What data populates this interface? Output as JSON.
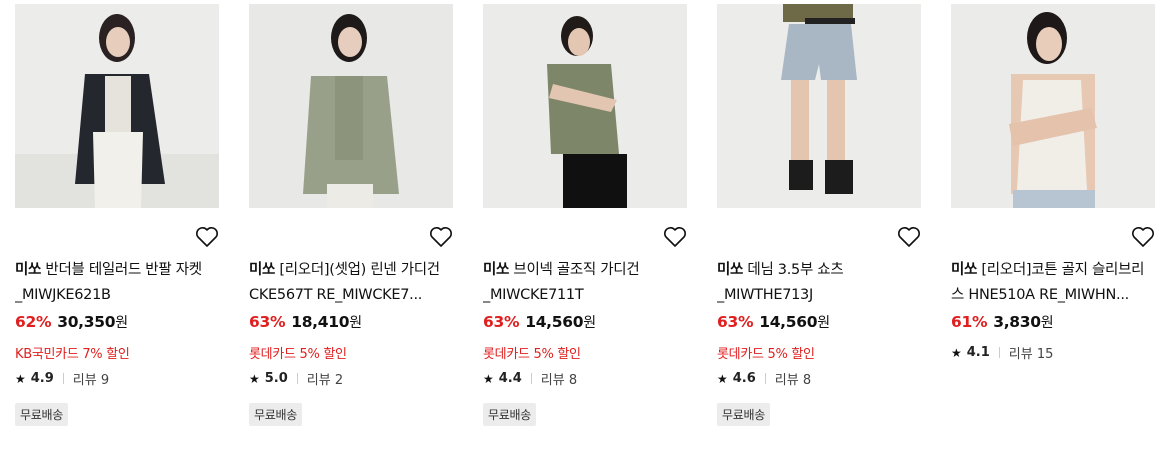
{
  "products": [
    {
      "brand": "미쏘",
      "name": "반더블 테일러드 반팔 자켓_MIWJKE621B",
      "discount": "62%",
      "price": "30,350",
      "currency": "원",
      "card_promo": "KB국민카드 7% 할인",
      "rating": "4.9",
      "reviews": "리뷰 9",
      "badge": "무료배송"
    },
    {
      "brand": "미쏘",
      "name": "[리오더](셋업) 린넨 가디건 CKE567T RE_MIWCKE7...",
      "discount": "63%",
      "price": "18,410",
      "currency": "원",
      "card_promo": "롯데카드 5% 할인",
      "rating": "5.0",
      "reviews": "리뷰 2",
      "badge": "무료배송"
    },
    {
      "brand": "미쏘",
      "name": "브이넥 골조직 가디건_MIWCKE711T",
      "discount": "63%",
      "price": "14,560",
      "currency": "원",
      "card_promo": "롯데카드 5% 할인",
      "rating": "4.4",
      "reviews": "리뷰 8",
      "badge": "무료배송"
    },
    {
      "brand": "미쏘",
      "name": "데님 3.5부 쇼츠_MIWTHE713J",
      "discount": "63%",
      "price": "14,560",
      "currency": "원",
      "card_promo": "롯데카드 5% 할인",
      "rating": "4.6",
      "reviews": "리뷰 8",
      "badge": "무료배송"
    },
    {
      "brand": "미쏘",
      "name": "[리오더]코튼 골지 슬리브리스 HNE510A RE_MIWHN...",
      "discount": "61%",
      "price": "3,830",
      "currency": "원",
      "rating": "4.1",
      "reviews": "리뷰 15"
    }
  ],
  "icons": {
    "wishlist": "heart-outline-icon",
    "rating": "star-icon"
  },
  "colors": {
    "discount": "#e02020",
    "promo": "#e02020",
    "badge_bg": "#ececec"
  }
}
